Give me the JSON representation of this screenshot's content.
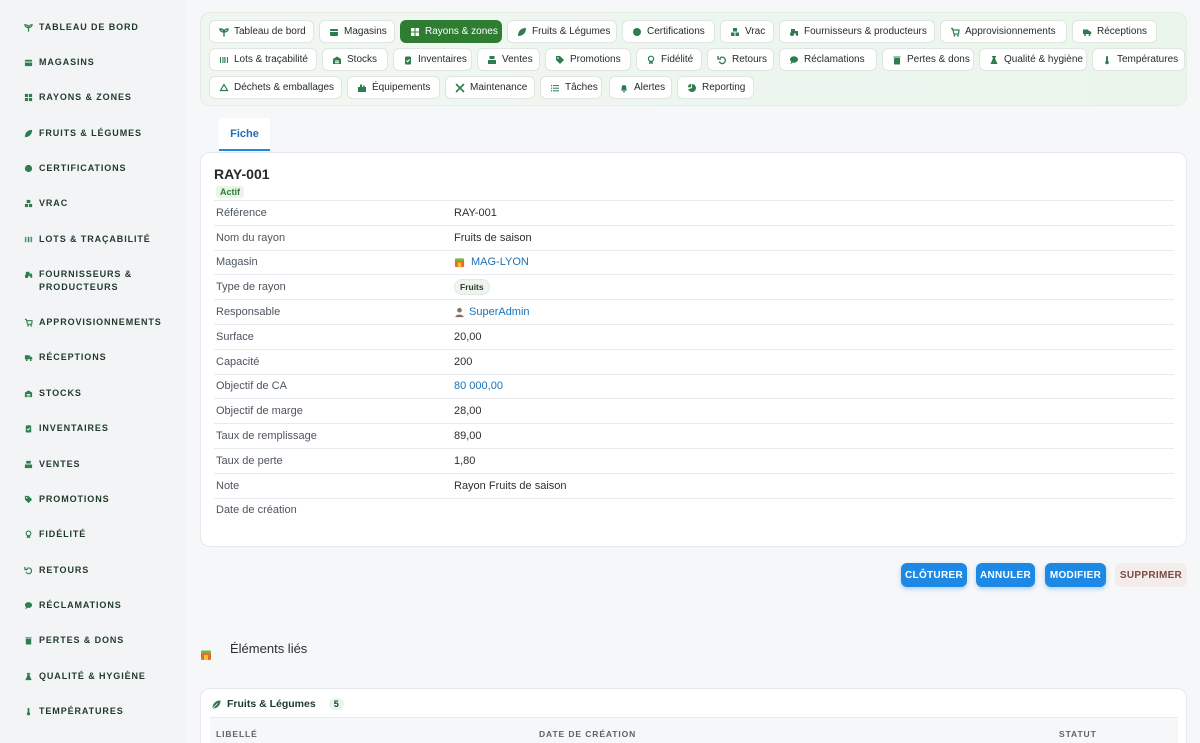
{
  "sidebar": {
    "items": [
      {
        "label": "Tableau de bord",
        "icon": "sprout-icon"
      },
      {
        "label": "Magasins",
        "icon": "store-icon"
      },
      {
        "label": "Rayons & zones",
        "icon": "grid-icon"
      },
      {
        "label": "Fruits & Légumes",
        "icon": "leaf-icon"
      },
      {
        "label": "Certifications",
        "icon": "badge-icon"
      },
      {
        "label": "Vrac",
        "icon": "boxes-icon"
      },
      {
        "label": "Lots & traçabilité",
        "icon": "barcode-icon"
      },
      {
        "label": "Fournisseurs & producteurs",
        "icon": "tractor-icon"
      },
      {
        "label": "Approvisionnements",
        "icon": "cart-icon"
      },
      {
        "label": "Réceptions",
        "icon": "truck-icon"
      },
      {
        "label": "Stocks",
        "icon": "warehouse-icon"
      },
      {
        "label": "Inventaires",
        "icon": "clipboard-icon"
      },
      {
        "label": "Ventes",
        "icon": "cash-register-icon"
      },
      {
        "label": "Promotions",
        "icon": "tag-icon"
      },
      {
        "label": "Fidélité",
        "icon": "award-icon"
      },
      {
        "label": "Retours",
        "icon": "undo-icon"
      },
      {
        "label": "Réclamations",
        "icon": "comment-icon"
      },
      {
        "label": "Pertes & dons",
        "icon": "trash-icon"
      },
      {
        "label": "Qualité & hygiène",
        "icon": "flask-icon"
      },
      {
        "label": "Températures",
        "icon": "thermometer-icon"
      }
    ]
  },
  "nav": {
    "chips": [
      {
        "label": "Tableau de bord",
        "icon": "sprout-icon",
        "active": false
      },
      {
        "label": "Magasins",
        "icon": "store-icon",
        "active": false
      },
      {
        "label": "Rayons & zones",
        "icon": "grid-icon",
        "active": true
      },
      {
        "label": "Fruits & Légumes",
        "icon": "leaf-icon",
        "active": false
      },
      {
        "label": "Certifications",
        "icon": "badge-icon",
        "active": false
      },
      {
        "label": "Vrac",
        "icon": "boxes-icon",
        "active": false
      },
      {
        "label": "Fournisseurs & producteurs",
        "icon": "tractor-icon",
        "active": false
      },
      {
        "label": "Approvisionnements",
        "icon": "cart-icon",
        "active": false
      },
      {
        "label": "Réceptions",
        "icon": "truck-icon",
        "active": false
      },
      {
        "label": "Lots & traçabilité",
        "icon": "barcode-icon",
        "active": false
      },
      {
        "label": "Stocks",
        "icon": "warehouse-icon",
        "active": false
      },
      {
        "label": "Inventaires",
        "icon": "clipboard-icon",
        "active": false
      },
      {
        "label": "Ventes",
        "icon": "cash-register-icon",
        "active": false
      },
      {
        "label": "Promotions",
        "icon": "tag-icon",
        "active": false
      },
      {
        "label": "Fidélité",
        "icon": "award-icon",
        "active": false
      },
      {
        "label": "Retours",
        "icon": "undo-icon",
        "active": false
      },
      {
        "label": "Réclamations",
        "icon": "comment-icon",
        "active": false
      },
      {
        "label": "Pertes & dons",
        "icon": "trash-icon",
        "active": false
      },
      {
        "label": "Qualité & hygiène",
        "icon": "flask-icon",
        "active": false
      },
      {
        "label": "Températures",
        "icon": "thermometer-icon",
        "active": false
      },
      {
        "label": "Déchets & emballages",
        "icon": "recycle-icon",
        "active": false
      },
      {
        "label": "Équipements",
        "icon": "equipment-icon",
        "active": false
      },
      {
        "label": "Maintenance",
        "icon": "tools-icon",
        "active": false
      },
      {
        "label": "Tâches",
        "icon": "list-icon",
        "active": false
      },
      {
        "label": "Alertes",
        "icon": "bell-icon",
        "active": false
      },
      {
        "label": "Reporting",
        "icon": "pie-chart-icon",
        "active": false
      }
    ]
  },
  "tab": {
    "label": "Fiche"
  },
  "record": {
    "title": "RAY-001",
    "status": "Actif",
    "fields": [
      {
        "label": "Référence",
        "value": "RAY-001",
        "kind": "text"
      },
      {
        "label": "Nom du rayon",
        "value": "Fruits de saison",
        "kind": "text"
      },
      {
        "label": "Magasin",
        "value": "MAG-LYON",
        "kind": "link-store"
      },
      {
        "label": "Type de rayon",
        "value": "Fruits",
        "kind": "pill"
      },
      {
        "label": "Responsable",
        "value": "SuperAdmin",
        "kind": "link-user"
      },
      {
        "label": "Surface",
        "value": "20,00",
        "kind": "text"
      },
      {
        "label": "Capacité",
        "value": "200",
        "kind": "text"
      },
      {
        "label": "Objectif de CA",
        "value": "80 000,00",
        "kind": "money"
      },
      {
        "label": "Objectif de marge",
        "value": "28,00",
        "kind": "text"
      },
      {
        "label": "Taux de remplissage",
        "value": "89,00",
        "kind": "text"
      },
      {
        "label": "Taux de perte",
        "value": "1,80",
        "kind": "text"
      },
      {
        "label": "Note",
        "value": "Rayon Fruits de saison",
        "kind": "text"
      },
      {
        "label": "Date de création",
        "value": "",
        "kind": "text"
      }
    ]
  },
  "actions": {
    "close": "CLÔTURER",
    "cancel": "ANNULER",
    "edit": "MODIFIER",
    "delete": "SUPPRIMER"
  },
  "linked": {
    "title": "Éléments liés",
    "section": {
      "title": "Fruits & Légumes",
      "count": "5",
      "columns": [
        "LIBELLÉ",
        "DATE DE CRÉATION",
        "STATUT"
      ]
    }
  },
  "colors": {
    "accent_green": "#2e7d32",
    "accent_blue": "#1e88e5",
    "link_blue": "#1a73b8"
  }
}
